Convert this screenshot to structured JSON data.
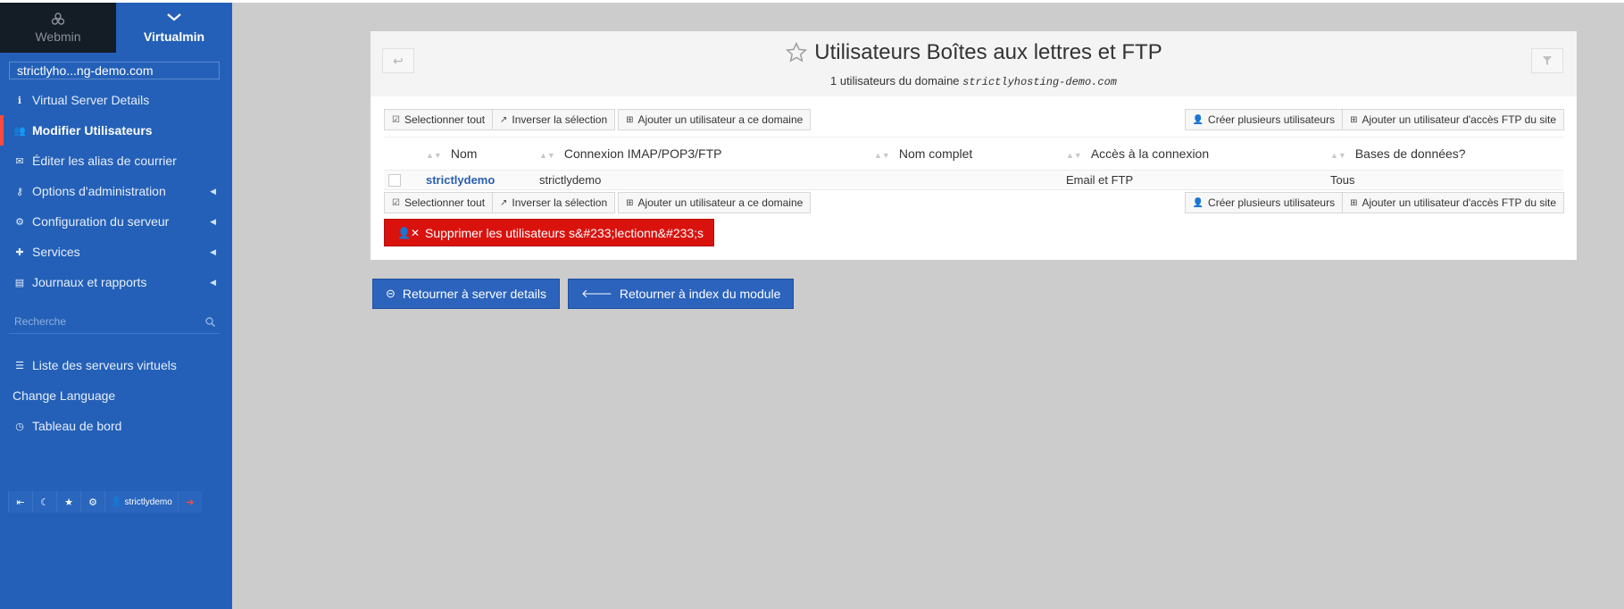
{
  "sidebar": {
    "tabs": {
      "webmin": "Webmin",
      "virtualmin": "Virtualmin"
    },
    "domain": "strictlyho...ng-demo.com",
    "items": [
      {
        "label": "Virtual Server Details",
        "icon": "info-icon"
      },
      {
        "label": "Modifier Utilisateurs",
        "icon": "users-icon"
      },
      {
        "label": "Éditer les alias de courrier",
        "icon": "envelope-icon"
      },
      {
        "label": "Options d'administration",
        "icon": "key-icon"
      },
      {
        "label": "Configuration du serveur",
        "icon": "cogs-icon"
      },
      {
        "label": "Services",
        "icon": "puzzle-icon"
      },
      {
        "label": "Journaux et rapports",
        "icon": "file-icon"
      }
    ],
    "search_placeholder": "Recherche",
    "links": [
      {
        "label": "Liste des serveurs virtuels",
        "icon": "server-list-icon"
      },
      {
        "label": "Change Language",
        "icon": ""
      },
      {
        "label": "Tableau de bord",
        "icon": "dashboard-icon"
      }
    ],
    "bottom": {
      "username": "strictlydemo"
    }
  },
  "panel": {
    "title": "Utilisateurs Boîtes aux lettres et FTP",
    "subtitle_prefix": "1 utilisateurs du domaine",
    "subtitle_domain": "strictlyhosting-demo.com",
    "toolbar": {
      "select_all": "Selectionner tout",
      "invert": "Inverser la sélection",
      "add_user": "Ajouter un utilisateur a ce domaine",
      "create_many": "Créer plusieurs utilisateurs",
      "add_ftp": "Ajouter un utilisateur d'accès FTP du site"
    },
    "table": {
      "headers": [
        "Nom",
        "Connexion IMAP/POP3/FTP",
        "Nom complet",
        "Accès à la connexion",
        "Bases de données?"
      ],
      "rows": [
        {
          "name": "strictlydemo",
          "login": "strictlydemo",
          "fullname": "",
          "access": "Email et FTP",
          "databases": "Tous"
        }
      ]
    },
    "delete_label": "Supprimer les utilisateurs s&#233;lectionn&#233;s"
  },
  "back_buttons": {
    "server_details": "Retourner à server details",
    "module_index": "Retourner à index du module"
  },
  "colors": {
    "sidebar": "#2460b7",
    "accent_red": "#d9120e",
    "primary": "#2b63bd"
  }
}
